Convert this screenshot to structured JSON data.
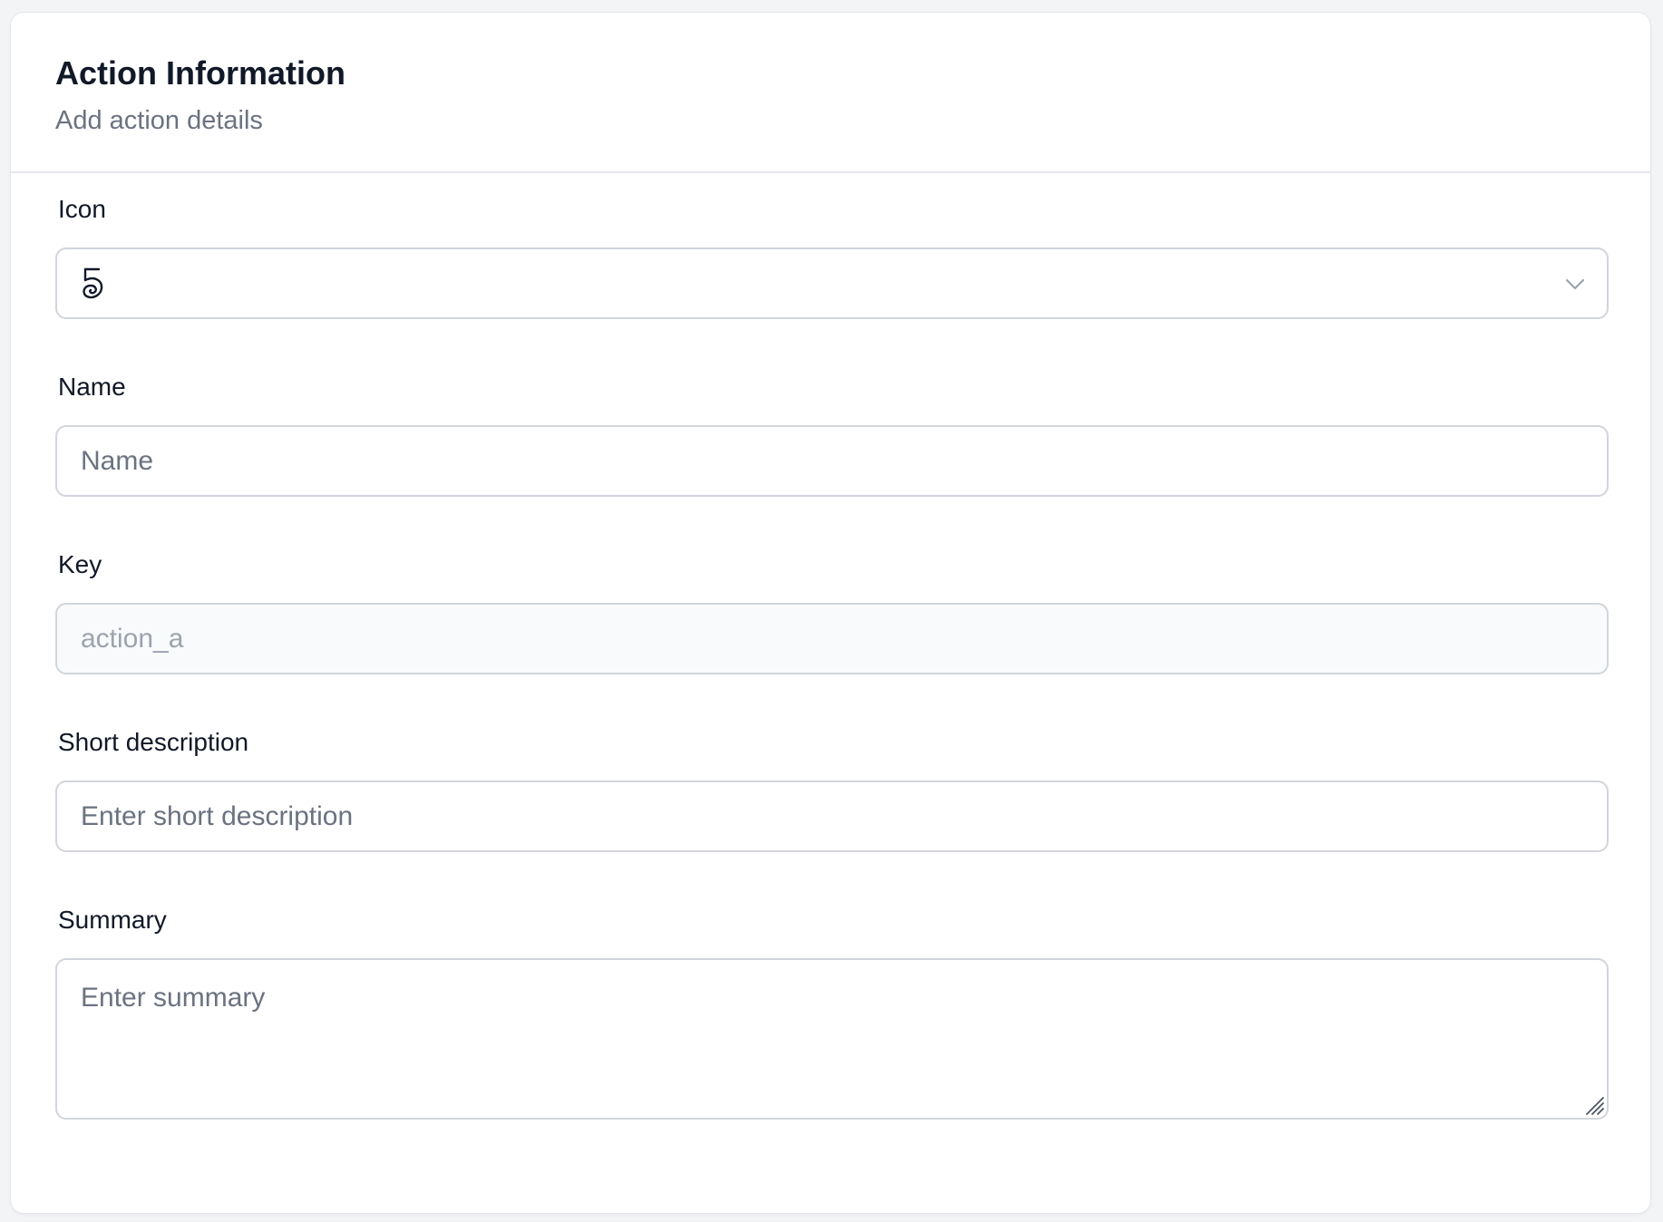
{
  "header": {
    "title": "Action Information",
    "subtitle": "Add action details"
  },
  "fields": {
    "icon": {
      "label": "Icon",
      "selected_icon": "five-swirl-icon"
    },
    "name": {
      "label": "Name",
      "placeholder": "Name",
      "value": ""
    },
    "key": {
      "label": "Key",
      "placeholder": "action_a",
      "value": "",
      "disabled": true
    },
    "short_description": {
      "label": "Short description",
      "placeholder": "Enter short description",
      "value": ""
    },
    "summary": {
      "label": "Summary",
      "placeholder": "Enter summary",
      "value": ""
    }
  },
  "icons": {
    "select_chevron": "chevron-down-icon",
    "textarea_resize": "resize-handle-icon"
  },
  "colors": {
    "background": "#f3f4f6",
    "card": "#ffffff",
    "border": "#d1d5db",
    "title": "#111827",
    "muted": "#6b7280",
    "disabled_bg": "#f9fafb"
  }
}
